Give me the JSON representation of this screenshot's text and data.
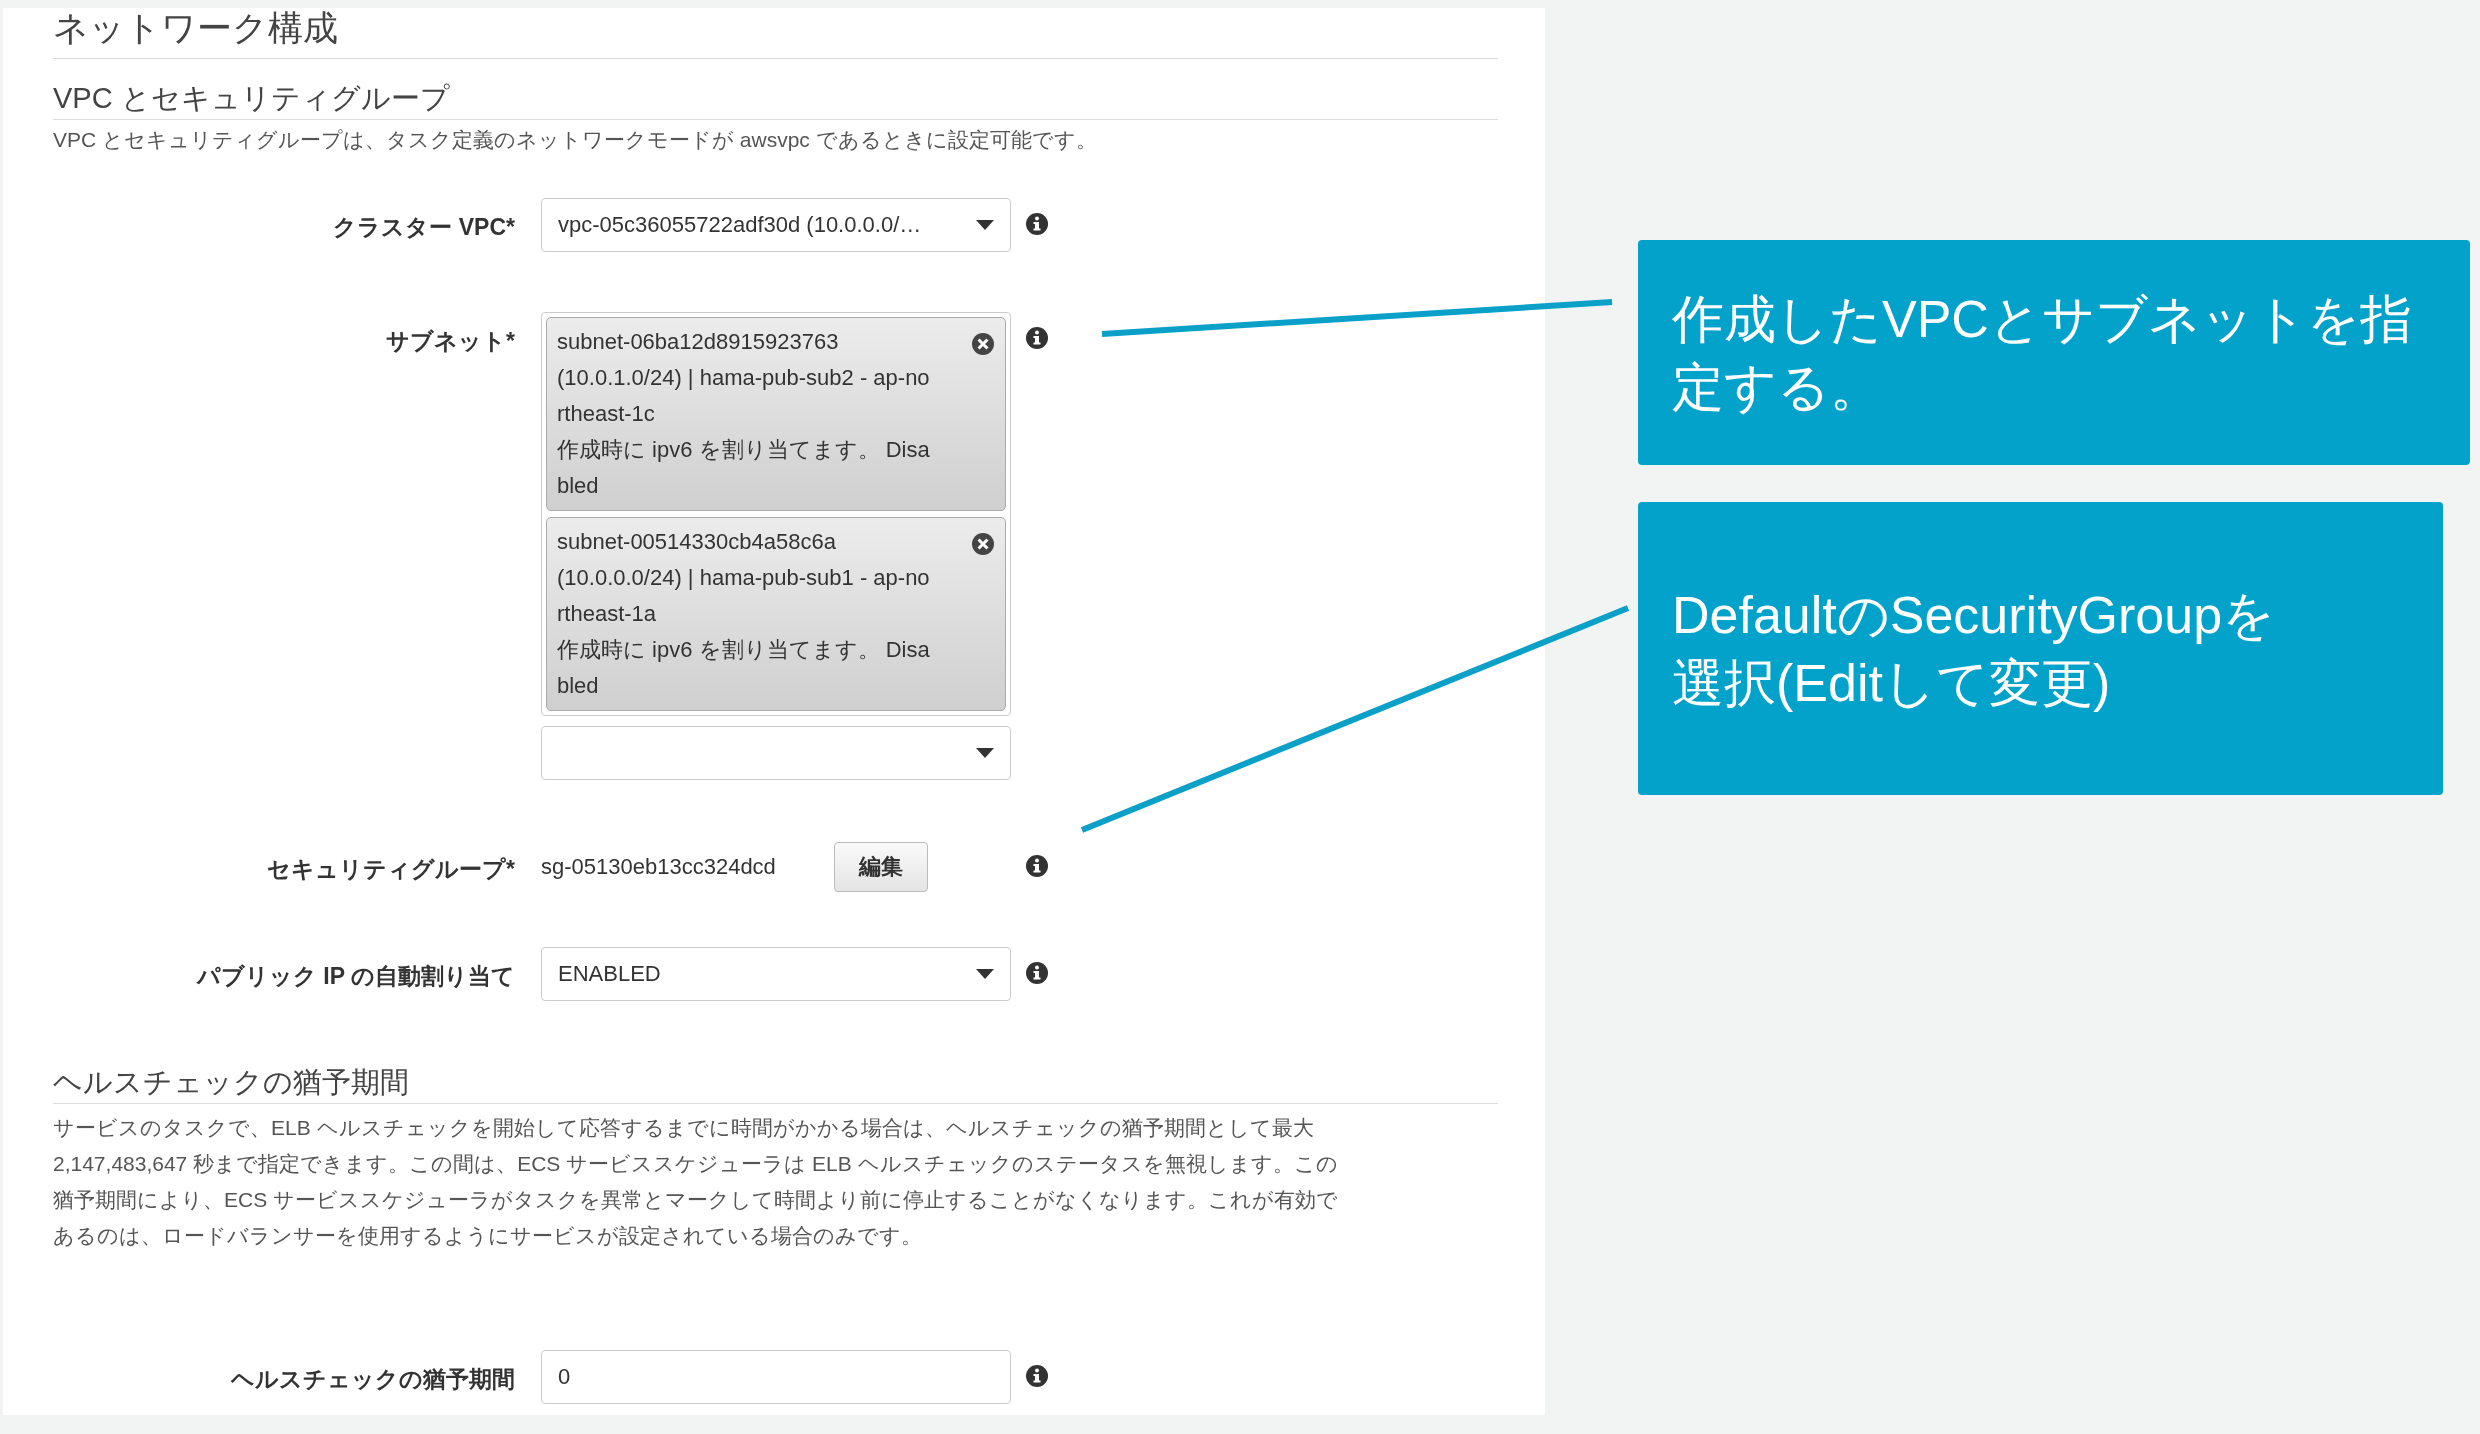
{
  "section_title": "ネットワーク構成",
  "vpc_section": {
    "heading": "VPC とセキュリティグループ",
    "description": "VPC とセキュリティグループは、タスク定義のネットワークモードが awsvpc であるときに設定可能です。"
  },
  "fields": [
    {
      "kind": "select",
      "label": "クラスター VPC*",
      "value": "vpc-05c36055722adf30d (10.0.0.0/…"
    },
    {
      "kind": "multiselect",
      "label": "サブネット*",
      "tokens": [
        {
          "lines": [
            "subnet-06ba12d8915923763",
            "(10.0.1.0/24) | hama-pub-sub2 - ap-no",
            "rtheast-1c",
            "作成時に ipv6 を割り当てます。 Disa",
            "bled"
          ]
        },
        {
          "lines": [
            "subnet-00514330cb4a58c6a",
            "(10.0.0.0/24) | hama-pub-sub1 - ap-no",
            "rtheast-1a",
            "作成時に ipv6 を割り当てます。 Disa",
            "bled"
          ]
        }
      ]
    },
    {
      "kind": "readonly",
      "label": "セキュリティグループ*",
      "value": "sg-05130eb13cc324dcd",
      "button": "編集"
    },
    {
      "kind": "select",
      "label": "パブリック IP の自動割り当て",
      "value": "ENABLED"
    }
  ],
  "health_section": {
    "heading": "ヘルスチェックの猶予期間",
    "description_lines": [
      "サービスのタスクで、ELB ヘルスチェックを開始して応答するまでに時間がかかる場合は、ヘルスチェックの猶予期間として最大",
      "2,147,483,647 秒まで指定できます。この間は、ECS サービススケジューラは ELB ヘルスチェックのステータスを無視します。この",
      "猶予期間により、ECS サービススケジューラがタスクを異常とマークして時間より前に停止することがなくなります。これが有効で",
      "あるのは、ロードバランサーを使用するようにサービスが設定されている場合のみです。"
    ],
    "fields": [
      {
        "kind": "input",
        "label": "ヘルスチェックの猶予期間",
        "value": "0"
      }
    ]
  },
  "callouts": [
    {
      "lines": [
        "作成したVPCとサブネットを指",
        "定する。"
      ]
    },
    {
      "lines": [
        "DefaultのSecurityGroupを",
        "選択(Editして変更)"
      ]
    }
  ]
}
